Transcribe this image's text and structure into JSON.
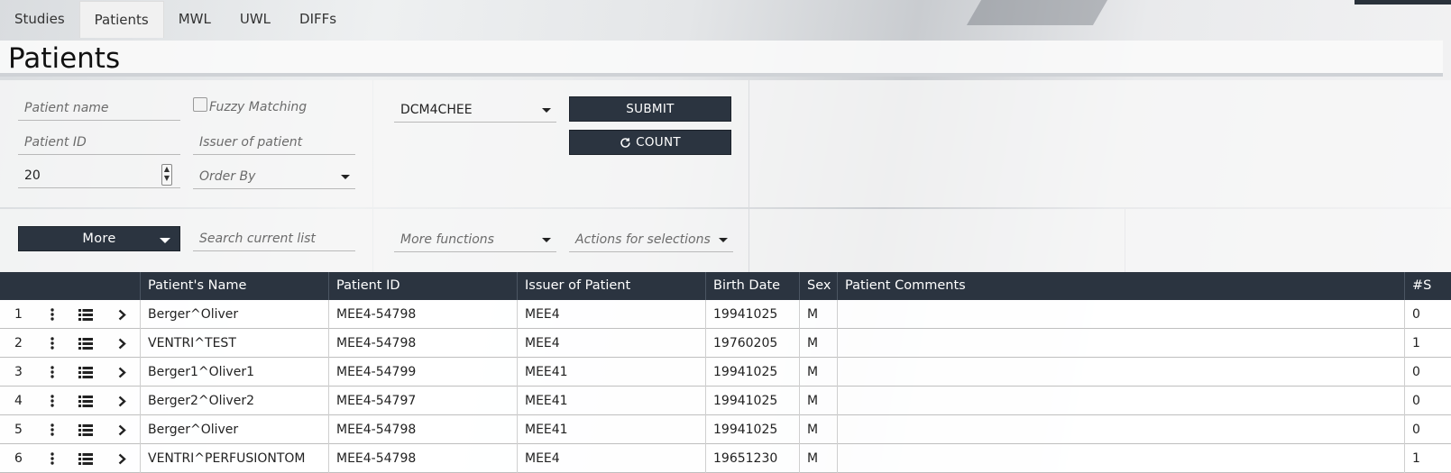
{
  "tabs": [
    {
      "label": "Studies",
      "active": false
    },
    {
      "label": "Patients",
      "active": true
    },
    {
      "label": "MWL",
      "active": false
    },
    {
      "label": "UWL",
      "active": false
    },
    {
      "label": "DIFFs",
      "active": false
    }
  ],
  "page_title": "Patients",
  "filters": {
    "patient_name_placeholder": "Patient name",
    "fuzzy_matching_label": "Fuzzy Matching",
    "patient_id_placeholder": "Patient ID",
    "issuer_placeholder": "Issuer of patient",
    "limit_value": "20",
    "order_by_placeholder": "Order By",
    "aet_value": "DCM4CHEE",
    "submit_label": "SUBMIT",
    "count_label": "COUNT"
  },
  "toolbar": {
    "more_label": "More",
    "search_placeholder": "Search current list",
    "more_functions": "More functions",
    "actions_for_selections": "Actions for selections"
  },
  "table": {
    "columns": [
      "Patient's Name",
      "Patient ID",
      "Issuer of Patient",
      "Birth Date",
      "Sex",
      "Patient Comments",
      "#S"
    ],
    "rows": [
      {
        "index": "1",
        "name": "Berger^Oliver",
        "pid": "MEE4-54798",
        "issuer": "MEE4",
        "birth": "19941025",
        "sex": "M",
        "comments": "",
        "series": "0"
      },
      {
        "index": "2",
        "name": "VENTRI^TEST",
        "pid": "MEE4-54798",
        "issuer": "MEE4",
        "birth": "19760205",
        "sex": "M",
        "comments": "",
        "series": "1"
      },
      {
        "index": "3",
        "name": "Berger1^Oliver1",
        "pid": "MEE4-54799",
        "issuer": "MEE41",
        "birth": "19941025",
        "sex": "M",
        "comments": "",
        "series": "0"
      },
      {
        "index": "4",
        "name": "Berger2^Oliver2",
        "pid": "MEE4-54797",
        "issuer": "MEE41",
        "birth": "19941025",
        "sex": "M",
        "comments": "",
        "series": "0"
      },
      {
        "index": "5",
        "name": "Berger^Oliver",
        "pid": "MEE4-54798",
        "issuer": "MEE41",
        "birth": "19941025",
        "sex": "M",
        "comments": "",
        "series": "0"
      },
      {
        "index": "6",
        "name": "VENTRI^PERFUSIONTOM",
        "pid": "MEE4-54798",
        "issuer": "MEE4",
        "birth": "19651230",
        "sex": "M",
        "comments": "",
        "series": "1"
      }
    ]
  },
  "row_icons": [
    "more-vertical-icon",
    "list-icon",
    "chevron-right-icon"
  ],
  "colors": {
    "header_bg": "#2b3440",
    "button_bg": "#2b3440"
  }
}
